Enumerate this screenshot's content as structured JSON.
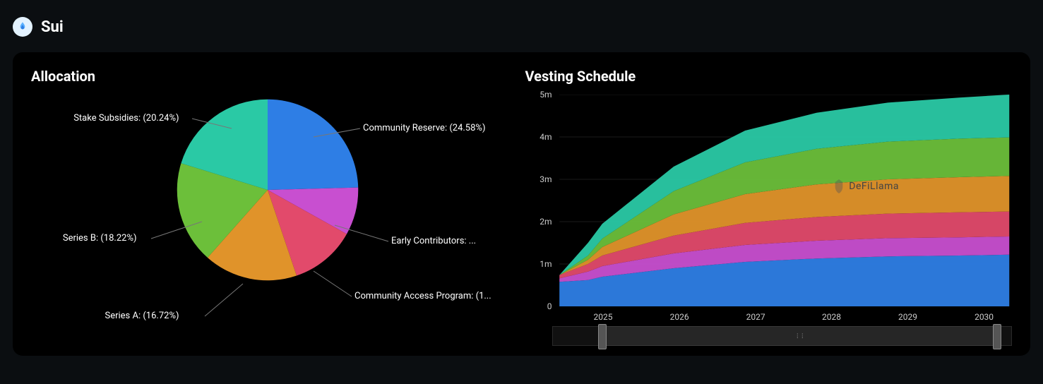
{
  "header": {
    "title": "Sui"
  },
  "allocation": {
    "title": "Allocation",
    "labels": {
      "community_reserve": "Community Reserve: (24.58%)",
      "early_contributors": "Early Contributors: ...",
      "community_access": "Community Access Program: (1...",
      "series_a": "Series A: (16.72%)",
      "series_b": "Series B: (18.22%)",
      "stake_subsidies": "Stake Subsidies: (20.24%)"
    }
  },
  "vesting": {
    "title": "Vesting Schedule",
    "yticks": {
      "t0": "0",
      "t1": "1m",
      "t2": "2m",
      "t3": "3m",
      "t4": "4m",
      "t5": "5m"
    },
    "xticks": {
      "x2025": "2025",
      "x2026": "2026",
      "x2027": "2027",
      "x2028": "2028",
      "x2029": "2029",
      "x2030": "2030"
    },
    "watermark": "DeFiLlama"
  },
  "chart_data": [
    {
      "type": "pie",
      "title": "Allocation",
      "series": [
        {
          "name": "Community Reserve",
          "value": 24.58,
          "color": "#2e7ee5"
        },
        {
          "name": "Early Contributors",
          "value": 8.52,
          "color": "#c84fd0"
        },
        {
          "name": "Community Access Program",
          "value": 11.72,
          "color": "#e24a6b"
        },
        {
          "name": "Series A",
          "value": 16.72,
          "color": "#e0932a"
        },
        {
          "name": "Series B",
          "value": 18.22,
          "color": "#6cbf3a"
        },
        {
          "name": "Stake Subsidies",
          "value": 20.24,
          "color": "#2ac9a5"
        }
      ]
    },
    {
      "type": "area",
      "title": "Vesting Schedule",
      "xlabel": "",
      "ylabel": "",
      "ylim": [
        0,
        5
      ],
      "y_unit": "m",
      "x": [
        2024.4,
        2024.8,
        2025,
        2026,
        2027,
        2028,
        2029,
        2030,
        2030.7
      ],
      "series": [
        {
          "name": "Community Reserve",
          "color": "#2e7ee5",
          "values": [
            0.58,
            0.62,
            0.7,
            0.9,
            1.05,
            1.13,
            1.18,
            1.2,
            1.22
          ]
        },
        {
          "name": "Early Contributors",
          "color": "#c84fd0",
          "values": [
            0.08,
            0.2,
            0.25,
            0.35,
            0.4,
            0.42,
            0.43,
            0.43,
            0.43
          ]
        },
        {
          "name": "Community Access Program",
          "color": "#e24a6b",
          "values": [
            0.08,
            0.18,
            0.25,
            0.42,
            0.52,
            0.56,
            0.58,
            0.59,
            0.59
          ]
        },
        {
          "name": "Series A",
          "color": "#e0932a",
          "values": [
            0.0,
            0.1,
            0.2,
            0.5,
            0.68,
            0.77,
            0.81,
            0.83,
            0.84
          ]
        },
        {
          "name": "Series B",
          "color": "#6cbf3a",
          "values": [
            0.0,
            0.1,
            0.2,
            0.55,
            0.75,
            0.84,
            0.89,
            0.91,
            0.91
          ]
        },
        {
          "name": "Stake Subsidies",
          "color": "#2ac9a5",
          "values": [
            0.0,
            0.3,
            0.35,
            0.58,
            0.75,
            0.85,
            0.92,
            0.97,
            1.01
          ]
        }
      ],
      "note": "values are per-series contributions in millions; stacked totals range ~0.74m (start) to ~5.0m (2030.7)"
    }
  ]
}
